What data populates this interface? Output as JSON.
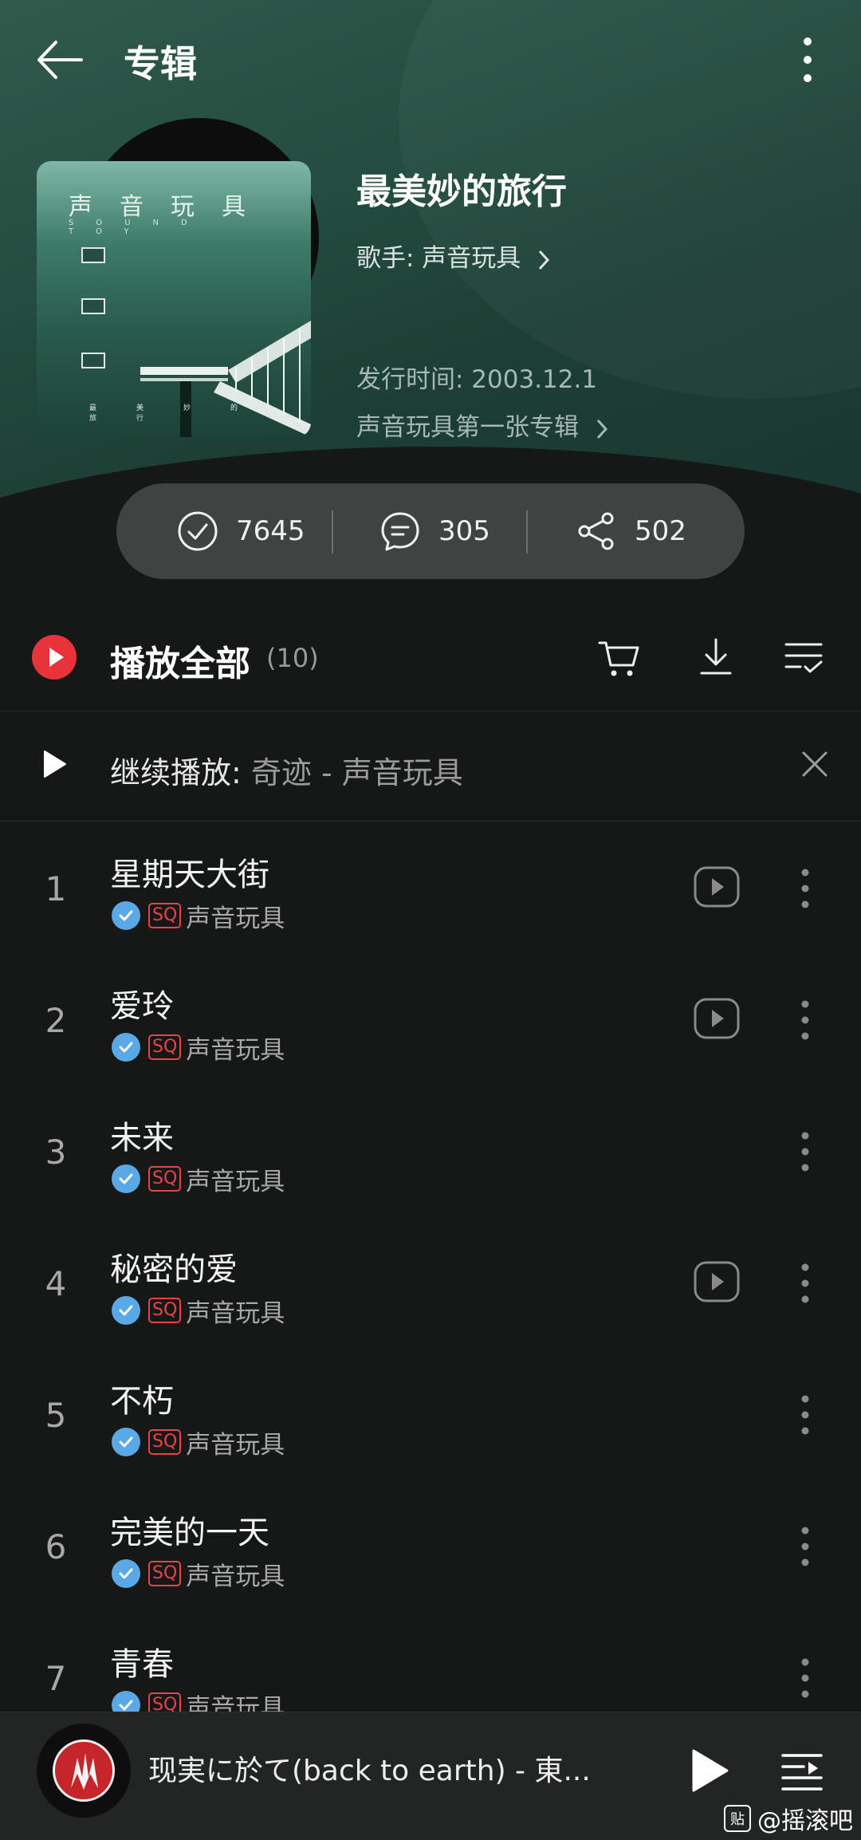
{
  "header": {
    "title": "专辑"
  },
  "album": {
    "cover_text": "声音玩具",
    "cover_subtext": "SOUND TOY",
    "cover_bottom_text": "最美妙的旅行",
    "name": "最美妙的旅行",
    "artist_label": "歌手: 声音玩具",
    "release_label": "发行时间: 2003.12.1",
    "description": "声音玩具第一张专辑"
  },
  "stats": {
    "collect": "7645",
    "comment": "305",
    "share": "502"
  },
  "play_all": {
    "label": "播放全部",
    "count": "(10)"
  },
  "continue": {
    "label": "继续播放: ",
    "track": "奇迹 - 声音玩具"
  },
  "tracks": [
    {
      "num": "1",
      "title": "星期天大街",
      "sq": "SQ",
      "artist": "声音玩具",
      "mv": true
    },
    {
      "num": "2",
      "title": "爱玲",
      "sq": "SQ",
      "artist": "声音玩具",
      "mv": true
    },
    {
      "num": "3",
      "title": "未来",
      "sq": "SQ",
      "artist": "声音玩具",
      "mv": false
    },
    {
      "num": "4",
      "title": "秘密的爱",
      "sq": "SQ",
      "artist": "声音玩具",
      "mv": true
    },
    {
      "num": "5",
      "title": "不朽",
      "sq": "SQ",
      "artist": "声音玩具",
      "mv": false
    },
    {
      "num": "6",
      "title": "完美的一天",
      "sq": "SQ",
      "artist": "声音玩具",
      "mv": false
    },
    {
      "num": "7",
      "title": "青春",
      "sq": "SQ",
      "artist": "声音玩具",
      "mv": false
    }
  ],
  "mini_player": {
    "title": "现実に於て(back to earth) - 東..."
  },
  "watermark": {
    "badge": "贴",
    "text": "@摇滚吧"
  },
  "colors": {
    "accent": "#e8333a",
    "verified": "#5aa8e6",
    "background": "#161717",
    "hero": "#244c40"
  }
}
